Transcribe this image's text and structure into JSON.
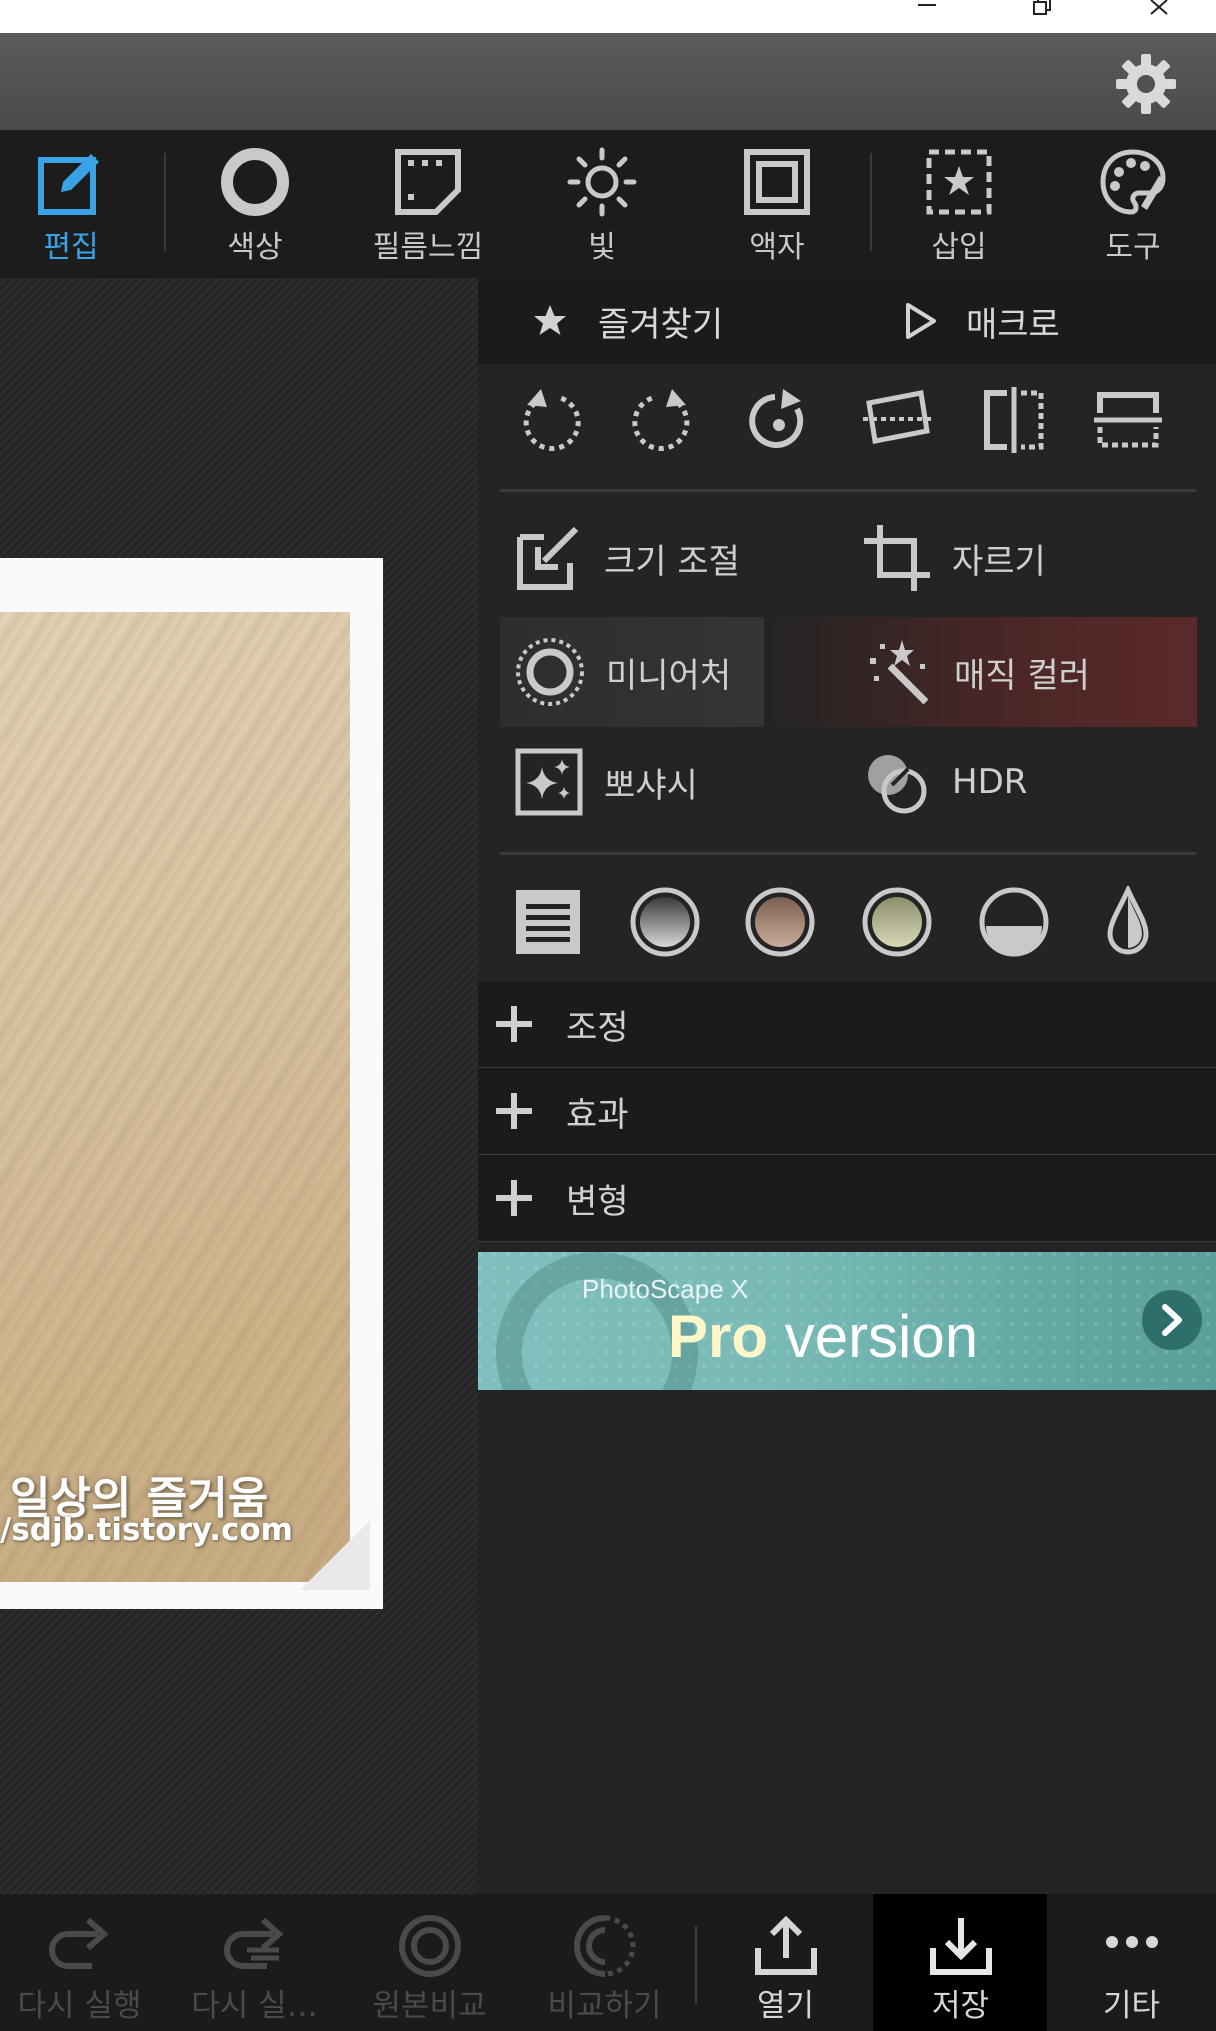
{
  "window": {
    "controls": [
      "minimize-icon",
      "restore-icon",
      "close-icon"
    ]
  },
  "header": {
    "settings_icon": "gear-icon"
  },
  "tabs": [
    {
      "label": "편집",
      "icon": "edit-icon",
      "active": true
    },
    {
      "label": "색상",
      "icon": "circle-icon",
      "active": false
    },
    {
      "label": "필름느낌",
      "icon": "film-icon",
      "active": false
    },
    {
      "label": "빛",
      "icon": "sun-icon",
      "active": false
    },
    {
      "label": "액자",
      "icon": "frame-icon",
      "active": false
    },
    {
      "label": "삽입",
      "icon": "insert-star-icon",
      "active": false
    },
    {
      "label": "도구",
      "icon": "palette-icon",
      "active": false
    }
  ],
  "canvas": {
    "watermark_line1": "일상의 즐거움",
    "watermark_line2": "/sdjb.tistory.com"
  },
  "panel": {
    "favorites_label": "즐겨찾기",
    "macro_label": "매크로",
    "transform_icons": [
      "rotate-left-icon",
      "rotate-right-icon",
      "rotate-arbitrary-icon",
      "straighten-icon",
      "flip-horizontal-icon",
      "flip-vertical-icon"
    ],
    "tools": [
      {
        "label": "크기 조절",
        "icon": "resize-icon"
      },
      {
        "label": "자르기",
        "icon": "crop-icon"
      },
      {
        "label": "미니어처",
        "icon": "miniature-icon"
      },
      {
        "label": "매직 컬러",
        "icon": "magic-wand-icon"
      },
      {
        "label": "뽀샤시",
        "icon": "bloom-sparkle-icon"
      },
      {
        "label": "HDR",
        "icon": "hdr-icon"
      }
    ],
    "filter_icons": [
      "list-icon",
      "gray-filter-icon",
      "sepia-filter-icon",
      "olive-filter-icon",
      "half-tone-icon",
      "drop-icon"
    ],
    "sections": [
      {
        "label": "조정"
      },
      {
        "label": "효과"
      },
      {
        "label": "변형"
      }
    ],
    "colors": {
      "accent": "#3aa3e6",
      "magic_highlight": "#5a2a2a"
    }
  },
  "promo": {
    "small": "PhotoScape X",
    "pro": "Pro",
    "version": " version"
  },
  "bottom": [
    {
      "label": "다시 실행",
      "enabled": false
    },
    {
      "label": "다시 실…",
      "enabled": false
    },
    {
      "label": "원본비교",
      "enabled": false
    },
    {
      "label": "비교하기",
      "enabled": false
    },
    {
      "label": "열기",
      "enabled": true
    },
    {
      "label": "저장",
      "enabled": true,
      "selected": true
    },
    {
      "label": "기타",
      "enabled": true
    }
  ]
}
